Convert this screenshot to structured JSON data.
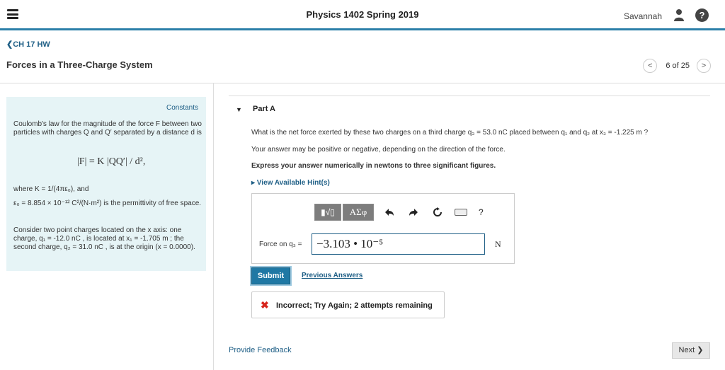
{
  "app": {
    "course_title": "Physics 1402 Spring 2019",
    "user_name": "Savannah",
    "help_label": "?"
  },
  "header": {
    "back_label": "CH 17 HW",
    "title": "Forces in a Three-Charge System",
    "pager_text": "6 of 25",
    "prev_label": "<",
    "next_label": ">"
  },
  "constants": {
    "title": "Constants",
    "intro": "Coulomb's law for the magnitude of the force F between two particles with charges Q and Q′ separated by a distance d is",
    "formula": "|F| = K |QQ′| / d²,",
    "where_k": "where K = 1/(4πε₀), and",
    "epsilon": "ε₀ = 8.854 × 10⁻¹² C²/(N·m²) is the permittivity of free space.",
    "scenario": "Consider two point charges located on the x axis: one charge, q₁ = -12.0 nC , is located at x₁ = -1.705 m ; the second charge, q₂ = 31.0 nC , is at the origin (x = 0.0000)."
  },
  "part": {
    "toggle_icon": "▼",
    "title": "Part A",
    "question": "What is the net force exerted by these two charges on a third charge q₃ = 53.0 nC placed between q₁ and q₂ at x₃ = -1.225 m ?",
    "note": "Your answer may be positive or negative, depending on the direction of the force.",
    "instruction": "Express your answer numerically in newtons to three significant figures.",
    "hints_label": "▸  View Available Hint(s)"
  },
  "answer": {
    "toolbar": {
      "sqrt_label": "▮√▯",
      "greek_label": "ΑΣφ",
      "undo_icon": "undo-icon",
      "redo_icon": "redo-icon",
      "reset_icon": "reset-icon",
      "keyboard_icon": "keyboard-icon",
      "help_label": "?"
    },
    "label": "Force on q₃ =",
    "value": "−3.103 • 10⁻⁵",
    "unit": "N"
  },
  "actions": {
    "submit_label": "Submit",
    "previous_answers_label": "Previous Answers"
  },
  "feedback": {
    "icon": "✖",
    "text": "Incorrect; Try Again; 2 attempts remaining"
  },
  "footer": {
    "provide_feedback_label": "Provide Feedback",
    "next_label": "Next ❯"
  },
  "colors": {
    "accent": "#2b7fa8",
    "link": "#1f5f86",
    "constants_bg": "#e6f4f6",
    "error": "#d7261e"
  }
}
